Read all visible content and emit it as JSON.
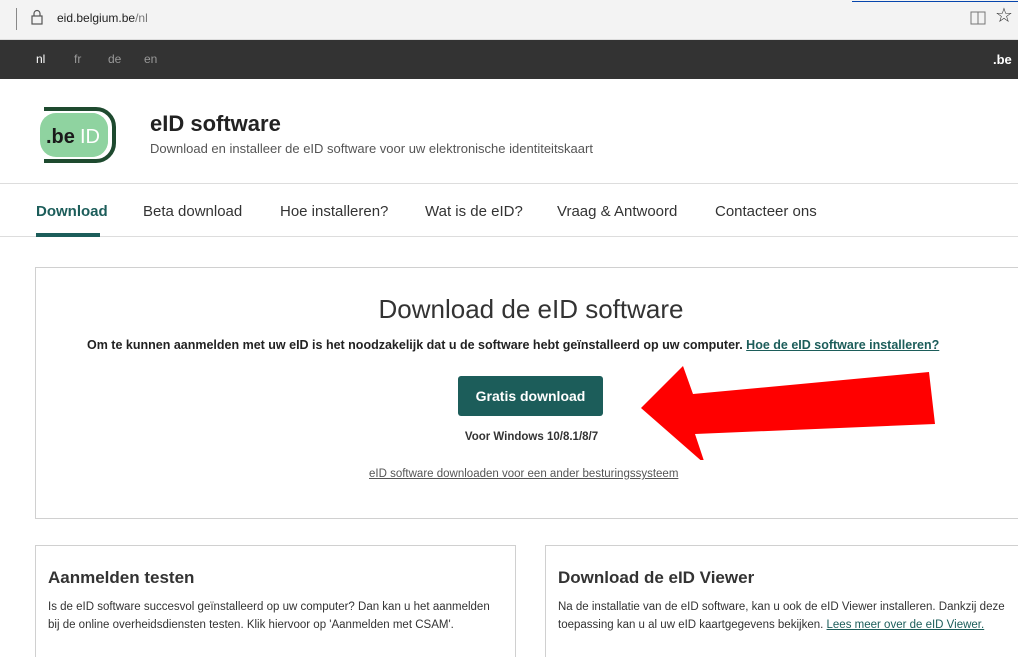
{
  "browser": {
    "url_domain": "eid.belgium.be",
    "url_path": "/nl",
    "icons": [
      "lock-icon",
      "reading-view-icon",
      "favorite-star-icon"
    ]
  },
  "langbar": {
    "languages": [
      "nl",
      "fr",
      "de",
      "en"
    ],
    "active": "nl",
    "brand": ".be"
  },
  "header": {
    "logo_text_be": ".be",
    "logo_text_id": "ID",
    "title": "eID software",
    "subtitle": "Download en installeer de eID software voor uw elektronische identiteitskaart"
  },
  "nav": {
    "items": [
      "Download",
      "Beta download",
      "Hoe installeren?",
      "Wat is de eID?",
      "Vraag & Antwoord",
      "Contacteer ons"
    ],
    "active": "Download"
  },
  "main": {
    "title": "Download de eID software",
    "description": "Om te kunnen aanmelden met uw eID is het noodzakelijk dat u de software hebt geïnstalleerd op uw computer.",
    "description_link": "Hoe de eID software installeren?",
    "button_label": "Gratis download",
    "os_label": "Voor Windows 10/8.1/8/7",
    "other_os_link": "eID software downloaden voor een ander besturingssysteem"
  },
  "cards": {
    "left": {
      "title": "Aanmelden testen",
      "text": "Is de eID software succesvol geïnstalleerd op uw computer? Dan kan u het aanmelden bij de online overheidsdiensten testen. Klik hiervoor op 'Aanmelden met CSAM'."
    },
    "right": {
      "title": "Download de eID Viewer",
      "text": "Na de installatie van de eID software, kan u ook de eID Viewer installeren. Dankzij deze toepassing kan u al uw eID kaartgegevens bekijken.",
      "link": "Lees meer over de eID Viewer."
    }
  },
  "colors": {
    "brand_green": "#1c5d5a",
    "logo_green": "#8fd3a0",
    "logo_dark": "#1e4a2f",
    "arrow_red": "#ff0000",
    "topbar_bg": "#333333"
  }
}
